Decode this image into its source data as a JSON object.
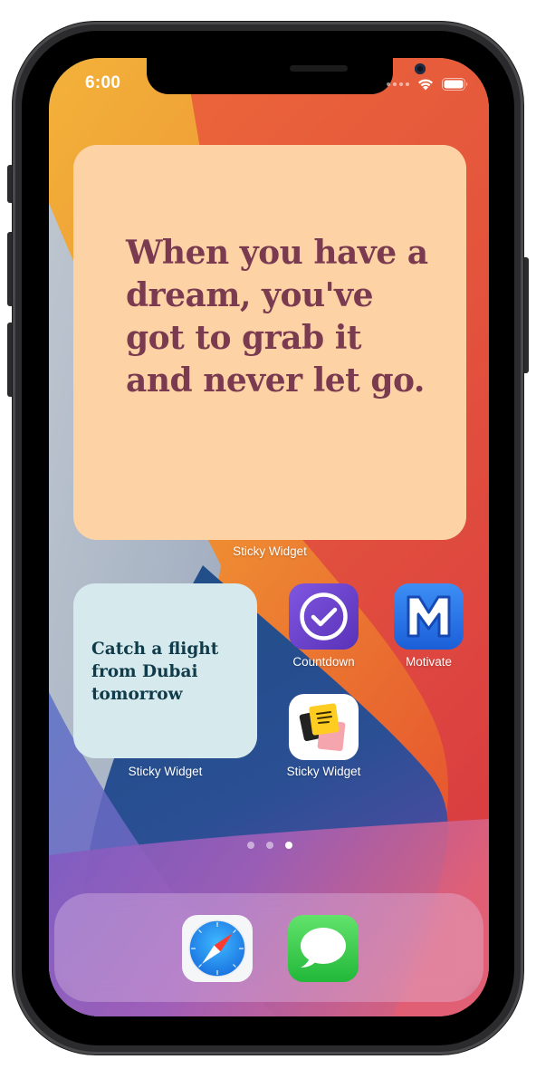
{
  "status_bar": {
    "time": "6:00"
  },
  "widgets": {
    "large": {
      "quote_text": "When you have a dream, you've got to grab it and never let go.",
      "label": "Sticky Widget",
      "background": "#fdd3a5",
      "text_color": "#7a3a4f"
    },
    "small": {
      "note_text": "Catch a flight from Dubai tomorrow",
      "label": "Sticky Widget",
      "background": "#d6eaee",
      "text_color": "#0f3b4a"
    }
  },
  "apps": [
    {
      "label": "Countdown",
      "icon": "countdown-check-icon",
      "color": "#6a44cc"
    },
    {
      "label": "Motivate",
      "icon": "motivate-m-icon",
      "color": "#2a73e8"
    },
    {
      "label": "Sticky Widget",
      "icon": "sticky-notes-icon",
      "color": "#ffffff"
    }
  ],
  "page_indicator": {
    "total": 3,
    "current": 3
  },
  "dock": [
    {
      "icon": "safari-compass-icon"
    },
    {
      "icon": "messages-bubble-icon"
    }
  ]
}
